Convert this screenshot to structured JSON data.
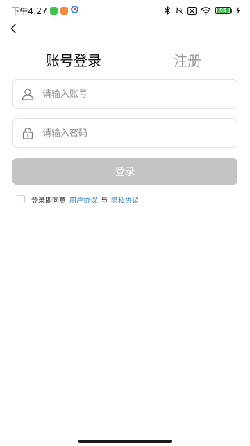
{
  "status_bar": {
    "time": "下午4:27",
    "battery_level": "95",
    "app_icons": [
      {
        "name": "wechat-app-icon",
        "color": "#3cc34a"
      },
      {
        "name": "shopping-app-icon",
        "color": "#f08a3c"
      },
      {
        "name": "browser-app-icon",
        "color": "#4a8be8"
      }
    ],
    "battery_color": "#3dbb4a"
  },
  "tabs": {
    "login": "账号登录",
    "register": "注册"
  },
  "account_field": {
    "placeholder": "请输入账号",
    "value": ""
  },
  "password_field": {
    "placeholder": "请输入密码",
    "value": ""
  },
  "login_button": {
    "label": "登录",
    "color": "#c4c4c4"
  },
  "agreement": {
    "prefix": "登录即同意",
    "user_agreement": "用户协议",
    "conjunction": "与",
    "privacy_agreement": "隐私协议",
    "link_color": "#2d7ec6"
  },
  "colors": {
    "active_tab": "#111111",
    "inactive_tab": "#9a9a9a"
  }
}
